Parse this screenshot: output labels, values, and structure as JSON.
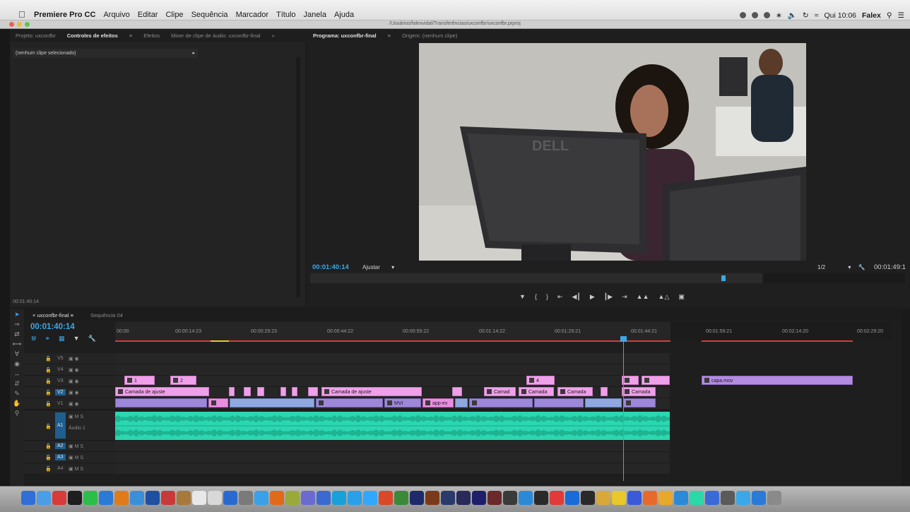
{
  "menubar": {
    "app_name": "Premiere Pro CC",
    "items": [
      "Arquivo",
      "Editar",
      "Clipe",
      "Sequência",
      "Marcador",
      "Título",
      "Janela",
      "Ajuda"
    ],
    "clock": "Qui 10:06",
    "user": "Falex"
  },
  "window": {
    "path": "/Usuários/falexvidal/Transferências/uxconfbr/uxconfbr.prproj"
  },
  "effects_panel": {
    "tabs": [
      "Projeto: uxconfbr",
      "Controles de efeitos",
      "Efeitos",
      "Mixer de clipe de áudio: uxconfbr-final"
    ],
    "active_tab": 1,
    "empty_row": "(nenhum clipe selecionado)",
    "timecode": "00:01:40:14"
  },
  "program_panel": {
    "tabs": [
      "Programa: uxconfbr-final",
      "Origem: (nenhum clipe)"
    ],
    "timecode_left": "00:01:40:14",
    "fit_label": "Ajustar",
    "resolution": "1/2",
    "timecode_right": "00:01:49:1",
    "playhead_fraction": 0.91
  },
  "timeline": {
    "tabs": [
      "uxconfbr-final",
      "Sequência 04"
    ],
    "timecode": "00:01:40:14",
    "ruler_ticks": [
      "00:00",
      "00:00:14:23",
      "00:00:29:23",
      "00:00:44:22",
      "00:00:59:22",
      "00:01:14:22",
      "00:01:29:21",
      "00:01:44:21",
      "00:01:59:21",
      "00:02:14:20",
      "00:02:29:20"
    ],
    "tracks": [
      {
        "name": "V5",
        "type": "video"
      },
      {
        "name": "V4",
        "type": "video"
      },
      {
        "name": "V3",
        "type": "video"
      },
      {
        "name": "V2",
        "type": "video",
        "targeted": true
      },
      {
        "name": "V1",
        "type": "video"
      },
      {
        "name": "A1",
        "type": "audio",
        "targeted": true,
        "label": "Áudio 1"
      },
      {
        "name": "A2",
        "type": "audio"
      },
      {
        "name": "A3",
        "type": "audio",
        "targeted": true
      },
      {
        "name": "A4",
        "type": "audio"
      }
    ],
    "clips": {
      "v3": [
        "1",
        "2",
        "4",
        "capa.mov"
      ],
      "v2": [
        "Camada de ajuste",
        "Camada de ajuste",
        "Camad",
        "Camada",
        "Camada",
        "Camada"
      ],
      "v1": [
        "MVI",
        "app-ex"
      ]
    },
    "track_icons": {
      "mute": "M",
      "solo": "S"
    }
  },
  "colors": {
    "timecode_blue": "#3aa8e8",
    "adjustment_pink": "#f0a0ea",
    "video_lavender": "#9d87d8",
    "audio_teal": "#2bd7b0",
    "inout_red": "#d83a3a"
  }
}
